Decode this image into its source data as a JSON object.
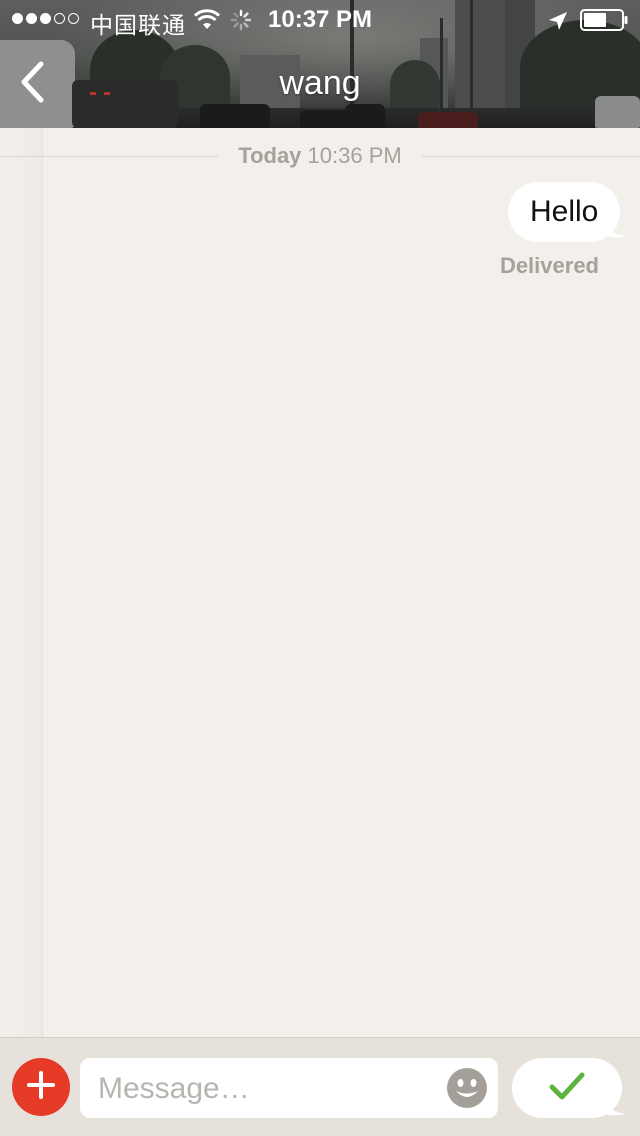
{
  "status_bar": {
    "carrier": "中国联通",
    "time": "10:37 PM",
    "signal_filled": 3,
    "signal_total": 5,
    "icons": [
      "wifi-icon",
      "activity-icon",
      "location-arrow-icon",
      "battery-icon"
    ]
  },
  "header": {
    "title": "wang",
    "back_icon": "chevron-left-icon"
  },
  "conversation": {
    "date_divider": {
      "day": "Today",
      "time": "10:36 PM"
    },
    "messages": [
      {
        "text": "Hello",
        "direction": "outgoing",
        "status": "Delivered"
      }
    ]
  },
  "input_bar": {
    "add_icon": "plus-icon",
    "placeholder": "Message…",
    "value": "",
    "emoji_icon": "smiley-icon",
    "send_icon": "checkmark-icon"
  },
  "colors": {
    "background": "#f3efea",
    "input_bar": "#e6e1db",
    "add_button": "#e53b26",
    "send_check": "#5db33c",
    "muted_text": "#a6a19b"
  }
}
